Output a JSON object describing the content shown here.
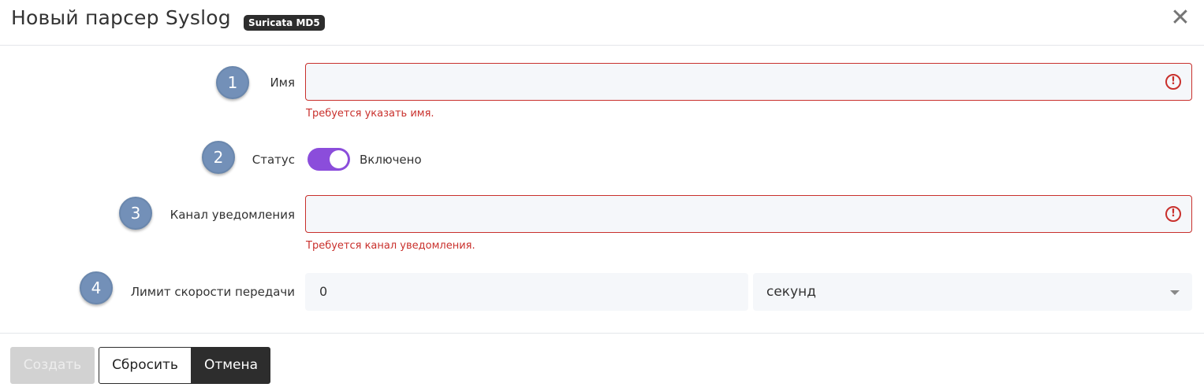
{
  "header": {
    "title": "Новый парсер Syslog",
    "badge": "Suricata MD5",
    "close_icon": "close-icon"
  },
  "steps": [
    "1",
    "2",
    "3",
    "4"
  ],
  "form": {
    "name": {
      "label": "Имя",
      "value": "",
      "error": "Требуется указать имя.",
      "error_icon": "exclamation-circle-icon"
    },
    "status": {
      "label": "Статус",
      "enabled": true,
      "state_text": "Включено"
    },
    "channel": {
      "label": "Канал уведомления",
      "value": "",
      "error": "Требуется канал уведомления.",
      "error_icon": "exclamation-circle-icon"
    },
    "rate_limit": {
      "label": "Лимит скорости передачи",
      "value": "0",
      "unit": "секунд"
    }
  },
  "footer": {
    "create_label": "Создать",
    "reset_label": "Сбросить",
    "cancel_label": "Отмена"
  },
  "colors": {
    "error": "#c9302c",
    "toggle_on": "#8b4ddb",
    "step_circle": "#7390b8",
    "dark_button": "#2d2d2d"
  }
}
